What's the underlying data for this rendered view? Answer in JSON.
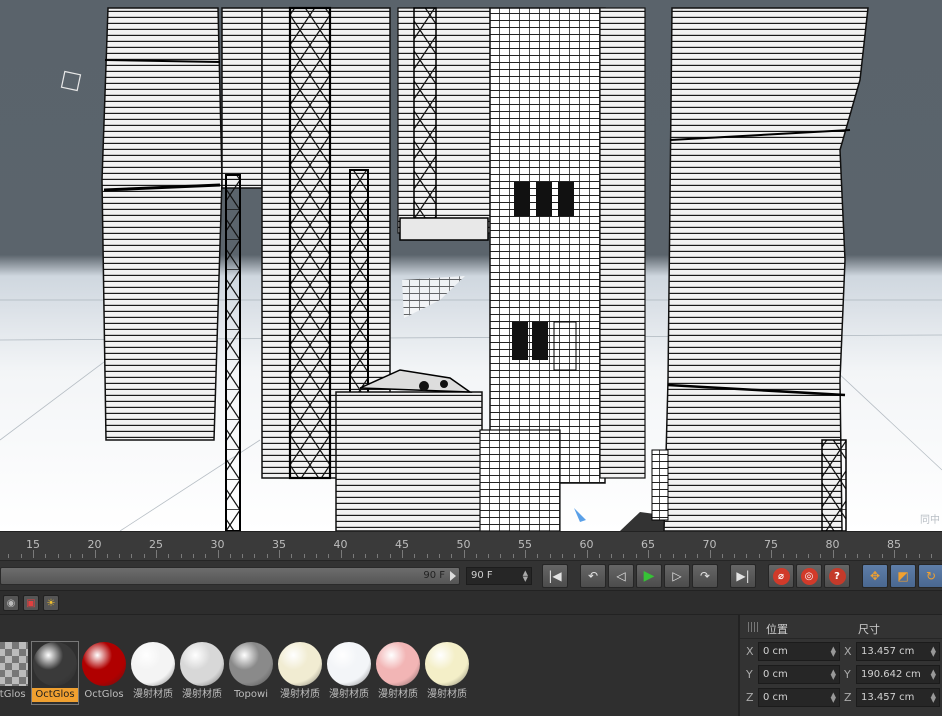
{
  "viewport": {
    "watermark": "同中"
  },
  "timeline": {
    "ticks": [
      "15",
      "20",
      "25",
      "30",
      "35",
      "40",
      "45",
      "50",
      "55",
      "60",
      "65",
      "70",
      "75",
      "80",
      "85"
    ],
    "slider_end_label": "90 F",
    "frame_field": "90 F"
  },
  "transport": {
    "buttons": [
      "goto-start",
      "prev-key",
      "prev-frame",
      "play",
      "next-frame",
      "next-key",
      "goto-end"
    ]
  },
  "materials": [
    {
      "name": "OctGlos",
      "color": "checker"
    },
    {
      "name": "OctGlos",
      "color": "#3a3a3a",
      "selected": true
    },
    {
      "name": "OctGlos",
      "color": "#b00000"
    },
    {
      "name": "漫射材质",
      "color": "#f4f4f4"
    },
    {
      "name": "漫射材质",
      "color": "#d8d8d8"
    },
    {
      "name": "Topowi",
      "color": "#8a8a8a"
    },
    {
      "name": "漫射材质",
      "color": "#f1ecd2"
    },
    {
      "name": "漫射材质",
      "color": "#f3f5f8"
    },
    {
      "name": "漫射材质",
      "color": "#f2b5b5"
    },
    {
      "name": "漫射材质",
      "color": "#f4efc8"
    }
  ],
  "attributes": {
    "header_position": "位置",
    "header_size": "尺寸",
    "rows": [
      {
        "axis": "X",
        "pos": "0 cm",
        "size_axis": "X",
        "size": "13.457 cm"
      },
      {
        "axis": "Y",
        "pos": "0 cm",
        "size_axis": "Y",
        "size": "190.642 cm"
      },
      {
        "axis": "Z",
        "pos": "0 cm",
        "size_axis": "Z",
        "size": "13.457 cm"
      }
    ]
  },
  "colors": {
    "accent_selected": "#f0a030",
    "play_green": "#36c236",
    "record_red": "#d13a2a",
    "help_red": "#c43a2a"
  }
}
